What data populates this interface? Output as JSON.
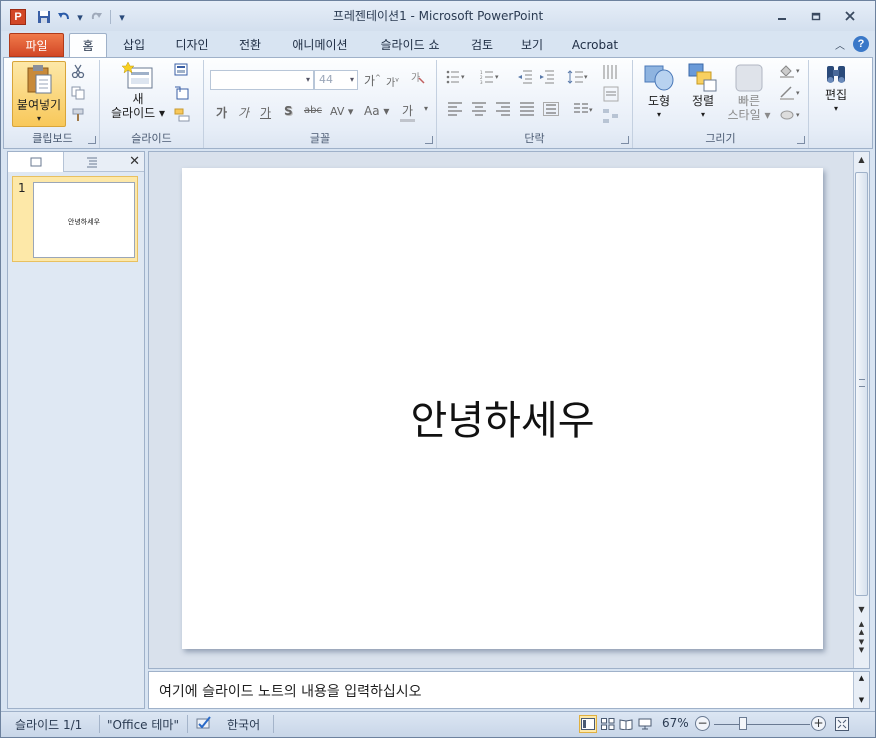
{
  "window": {
    "title": "프레젠테이션1 - Microsoft PowerPoint",
    "app_icon_letter": "P"
  },
  "tabs": [
    {
      "label": "파일"
    },
    {
      "label": "홈"
    },
    {
      "label": "삽입"
    },
    {
      "label": "디자인"
    },
    {
      "label": "전환"
    },
    {
      "label": "애니메이션"
    },
    {
      "label": "슬라이드 쇼"
    },
    {
      "label": "검토"
    },
    {
      "label": "보기"
    },
    {
      "label": "Acrobat"
    }
  ],
  "ribbon": {
    "clipboard": {
      "label": "클립보드",
      "paste": "붙여넣기"
    },
    "slides": {
      "label": "슬라이드",
      "new_slide_1": "새",
      "new_slide_2": "슬라이드"
    },
    "font": {
      "label": "글꼴",
      "font_name": "",
      "font_size": "44"
    },
    "paragraph": {
      "label": "단락"
    },
    "drawing": {
      "label": "그리기",
      "shapes": "도형",
      "arrange": "정렬",
      "quick_styles_1": "빠른",
      "quick_styles_2": "스타일"
    },
    "editing": {
      "label": "편집"
    },
    "glyphs": {
      "grow": "가",
      "shrink": "가",
      "bold": "가",
      "italic": "가",
      "underline": "가",
      "shadow": "S",
      "strike": "abc",
      "spacing": "AV",
      "case": "Aa",
      "color": "가"
    }
  },
  "slides_panel": {
    "thumbnails": [
      {
        "number": "1",
        "text": "안녕하세우"
      }
    ]
  },
  "slide": {
    "text": "안녕하세우"
  },
  "notes": {
    "placeholder": "여기에 슬라이드 노트의 내용을 입력하십시오"
  },
  "status": {
    "slide_pos": "슬라이드 1/1",
    "theme": "\"Office 테마\"",
    "language": "한국어",
    "zoom": "67%"
  },
  "colors": {
    "file_tab": "#d24726",
    "accent": "#3a78c8"
  }
}
